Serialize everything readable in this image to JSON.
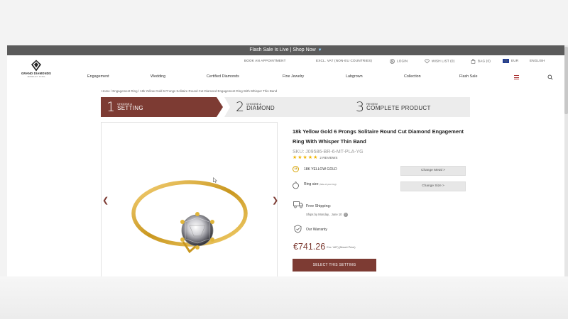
{
  "flash_bar": {
    "text": "Flash Sale Is Live | Shop Now"
  },
  "topbar": {
    "appointment": "BOOK AN APPOINTMENT",
    "vat": "EXCL. VAT (NON-EU COUNTRIES)",
    "login": "LOGIN",
    "wishlist": "WISH LIST (0)",
    "bag": "BAG (0)",
    "currency": "EUR",
    "language": "ENGLISH"
  },
  "logo": {
    "line1": "GRAND DIAMONDS",
    "line2": "JEWELRY RING"
  },
  "nav": {
    "items": [
      "Engagement",
      "Wedding",
      "Certified Diamonds",
      "Fine Jewelry",
      "Labgrown",
      "Collection",
      "Flash Sale"
    ]
  },
  "breadcrumb": "Home / Engagement Ring / 18k Yellow Gold 6 Prongs Solitaire Round Cut Diamond Engagement Ring With Whisper Thin Band",
  "steps": [
    {
      "num": "1",
      "small": "CHOOSE A",
      "big": "SETTING"
    },
    {
      "num": "2",
      "small": "CHOOSE A",
      "big": "DIAMOND"
    },
    {
      "num": "3",
      "small": "REVIEW",
      "big": "COMPLETE PRODUCT"
    }
  ],
  "product": {
    "title_line1": "18k Yellow Gold 6 Prongs Solitaire Round Cut Diamond Engagement",
    "title_line2": "Ring With Whisper Thin Band",
    "sku": "SKU: J09586-BR-6-MT-PLA-YG",
    "stars": "★★★★★",
    "reviews": "2 REVIEWS",
    "metal_badge": "18",
    "metal": "18K YELLOW GOLD",
    "change_metal": "Change Metal >",
    "ring_size": "Ring size",
    "ring_size_note": "(Size of your ring)",
    "change_size": "Change Size >",
    "shipping_title": "Free Shipping:",
    "shipping_sub": "Ships by Monday , June 10",
    "warranty": "Our Warranty",
    "price": "€741.26",
    "vat_note": "Exc. VAT) (Mount Price)",
    "select_button": "SELECT THIS SETTING"
  },
  "colors": {
    "brand": "#7d3b33",
    "gold": "#d8a400",
    "flash_bg": "#5b5b5b"
  }
}
